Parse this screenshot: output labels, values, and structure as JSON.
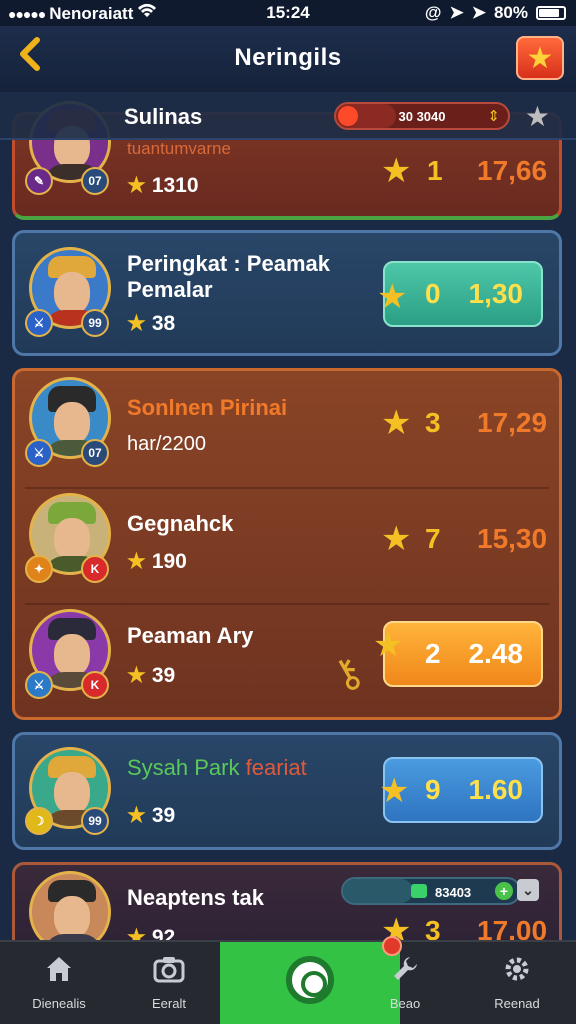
{
  "status_bar": {
    "carrier": "Nenoraiatt",
    "time": "15:24",
    "battery": "80%"
  },
  "header": {
    "title": "Neringils"
  },
  "sticky_row": {
    "name": "Sulinas",
    "progress_text": "30 3040",
    "progress_fraction": 0.35
  },
  "cards": [
    {
      "subtitle": "tuantumvarne",
      "score": "1310",
      "rank": "1",
      "value": "17,66",
      "badge": "07"
    },
    {
      "title": "Peringkat : Peamak",
      "subtitle": "Pemalar",
      "score": "38",
      "rank": "0",
      "value": "1,30",
      "badge": "99"
    },
    {
      "entries": [
        {
          "name": "Sonlnen Pirinai",
          "score": "har/2200",
          "rank": "3",
          "value": "17,29",
          "badge": "07"
        },
        {
          "name": "Gegnahck",
          "score": "190",
          "rank": "7",
          "value": "15,30",
          "badge": "K"
        },
        {
          "name": "Peaman Ary",
          "score": "39",
          "rank": "2",
          "value": "2.48",
          "badge": "K"
        }
      ]
    },
    {
      "name_part1": "Sysah Park",
      "name_part2": "feariat",
      "score": "39",
      "rank": "9",
      "value": "1.60",
      "badge": "99"
    },
    {
      "name": "Neaptens tak",
      "score": "92",
      "rank": "3",
      "value": "17,00",
      "mini_bar_text": "83403"
    }
  ],
  "tabbar": {
    "tabs": [
      {
        "label": "Dienealis",
        "icon": "home-icon"
      },
      {
        "label": "Eeralt",
        "icon": "camera-icon"
      },
      {
        "label": "",
        "icon": "target-icon"
      },
      {
        "label": "Beao",
        "icon": "wrench-icon"
      },
      {
        "label": "Reenad",
        "icon": "gear-icon"
      }
    ]
  },
  "colors": {
    "accent_gold": "#f5c023",
    "value_orange": "#f07a2a",
    "tab_active": "#34c244",
    "header_bg": "#1d2d4b"
  }
}
